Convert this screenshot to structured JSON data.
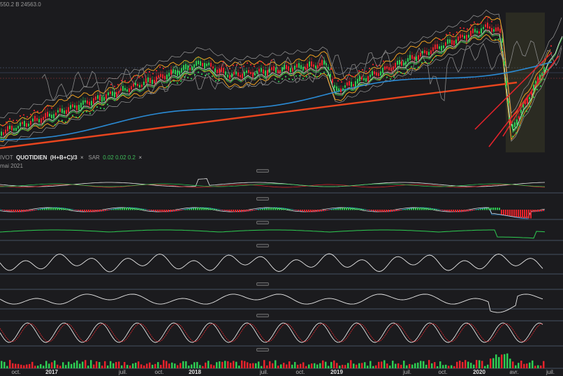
{
  "header": {
    "price_text": "550.2 B 24563.0",
    "indicator_prefix": "IVOT",
    "indicator_name": "QUOTIDIEN",
    "indicator_formula": "(H+B+C)/3",
    "close_symbol": "×",
    "sar_label": "SAR",
    "sar_params": "0.02  0.02  0.2",
    "date_text": "mai 2021"
  },
  "colors": {
    "background": "#1b1b1e",
    "up": "#2ecc52",
    "down": "#e8232b",
    "ema_long": "#e8451e",
    "ema_mid": "#2a8ad4",
    "ema_short": "#3aa845",
    "bollinger": "#f0a020",
    "envelope": "#9a9a9a",
    "white_line": "#e8e8e8"
  },
  "chart_data": {
    "type": "line",
    "x_ticks": [
      {
        "label": "oct.",
        "year": false
      },
      {
        "label": "2017",
        "year": true
      },
      {
        "label": "juil.",
        "year": false
      },
      {
        "label": "oct.",
        "year": false
      },
      {
        "label": "2018",
        "year": true
      },
      {
        "label": "juil.",
        "year": false
      },
      {
        "label": "oct.",
        "year": false
      },
      {
        "label": "2019",
        "year": true
      },
      {
        "label": "juil.",
        "year": false
      },
      {
        "label": "oct.",
        "year": false
      },
      {
        "label": "2020",
        "year": true
      },
      {
        "label": "avr.",
        "year": false
      },
      {
        "label": "juil.",
        "year": false
      }
    ],
    "series": [
      {
        "name": "QUOTIDIEN (H+B+C)/3",
        "values": []
      },
      {
        "name": "SAR 0.02 0.02 0.2",
        "values": []
      }
    ],
    "grid": false,
    "panels": [
      "price",
      "oscillator-1",
      "macd",
      "histogram",
      "oscillator-2",
      "oscillator-3",
      "stochastic",
      "volume"
    ]
  }
}
